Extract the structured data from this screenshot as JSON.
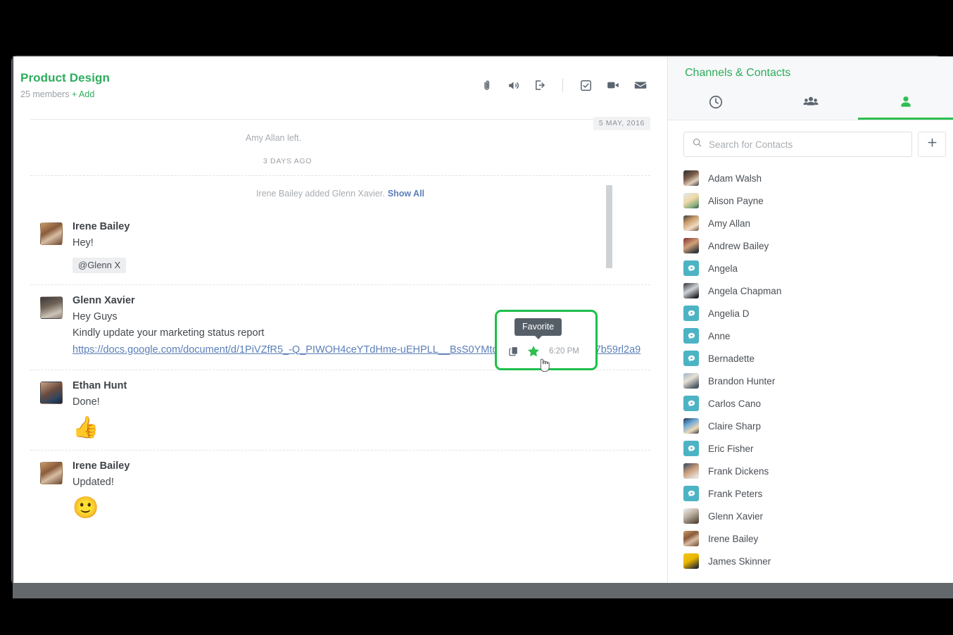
{
  "channel": {
    "title": "Product Design",
    "members_text": "25 members",
    "add_label": "+ Add",
    "icons": [
      "paperclip-icon",
      "speaker-icon",
      "exit-icon",
      "task-icon",
      "video-icon",
      "mail-icon"
    ]
  },
  "stream": {
    "date_chip": "5 MAY, 2016",
    "left_notice": "Amy Allan left.",
    "relative_time": "3 DAYS AGO",
    "added_notice": "Irene Bailey added Glenn Xavier.",
    "show_all_label": "Show All",
    "messages": [
      {
        "author": "Irene Bailey",
        "avatar_class": "av-irene",
        "lines": [
          "Hey!"
        ],
        "mention": "@Glenn X",
        "link": "",
        "emoji": ""
      },
      {
        "author": "Glenn Xavier",
        "avatar_class": "av-glenn",
        "lines": [
          "Hey Guys",
          "Kindly update your marketing status report"
        ],
        "mention": "",
        "link": "https://docs.google.com/document/d/1PiVZfR5_-Q_PIWOH4ceYTdHme-uEHPLL__BsS0YMtqQ/edit#heading=h.lop7b59rl2a9",
        "emoji": ""
      },
      {
        "author": "Ethan Hunt",
        "avatar_class": "av-ethan",
        "lines": [
          "Done!"
        ],
        "mention": "",
        "link": "",
        "emoji": "👍"
      },
      {
        "author": "Irene Bailey",
        "avatar_class": "av-irene",
        "lines": [
          "Updated!"
        ],
        "mention": "",
        "link": "",
        "emoji": "🙂"
      }
    ]
  },
  "favorite_card": {
    "tooltip": "Favorite",
    "timestamp": "6:20 PM",
    "star_color": "#2dbe51",
    "border_color": "#1dbf4a",
    "copy_icon": "copy-icon",
    "star_icon": "star-icon"
  },
  "side": {
    "title": "Channels & Contacts",
    "tabs": [
      {
        "name": "recent",
        "icon": "clock-icon",
        "active": false
      },
      {
        "name": "channels",
        "icon": "group-icon",
        "active": false
      },
      {
        "name": "contacts",
        "icon": "person-icon",
        "active": true
      }
    ],
    "search_placeholder": "Search for Contacts",
    "search_value": "",
    "add_button_icon": "plus-icon",
    "contacts": [
      {
        "name": "Adam Walsh",
        "avatar": "photo",
        "style": "g1"
      },
      {
        "name": "Alison Payne",
        "avatar": "photo",
        "style": "g2"
      },
      {
        "name": "Amy Allan",
        "avatar": "photo",
        "style": "g3"
      },
      {
        "name": "Andrew Bailey",
        "avatar": "photo",
        "style": "g4"
      },
      {
        "name": "Angela",
        "avatar": "placeholder",
        "style": ""
      },
      {
        "name": "Angela Chapman",
        "avatar": "photo",
        "style": "g5"
      },
      {
        "name": "Angelia D",
        "avatar": "placeholder",
        "style": ""
      },
      {
        "name": "Anne",
        "avatar": "placeholder",
        "style": ""
      },
      {
        "name": "Bernadette",
        "avatar": "placeholder",
        "style": ""
      },
      {
        "name": "Brandon Hunter",
        "avatar": "photo",
        "style": "g6"
      },
      {
        "name": "Carlos Cano",
        "avatar": "placeholder",
        "style": ""
      },
      {
        "name": "Claire Sharp",
        "avatar": "photo",
        "style": "g8"
      },
      {
        "name": "Eric Fisher",
        "avatar": "placeholder",
        "style": ""
      },
      {
        "name": "Frank Dickens",
        "avatar": "photo",
        "style": "g7"
      },
      {
        "name": "Frank Peters",
        "avatar": "placeholder",
        "style": ""
      },
      {
        "name": "Glenn Xavier",
        "avatar": "photo",
        "style": "g10"
      },
      {
        "name": "Irene Bailey",
        "avatar": "photo",
        "style": "g11"
      },
      {
        "name": "James Skinner",
        "avatar": "photo",
        "style": "g12"
      }
    ]
  },
  "colors": {
    "brand_green": "#2dac5c",
    "accent_green": "#2dbe51",
    "link_blue": "#5b7fb9",
    "placeholder_teal": "#4cb3c4"
  }
}
